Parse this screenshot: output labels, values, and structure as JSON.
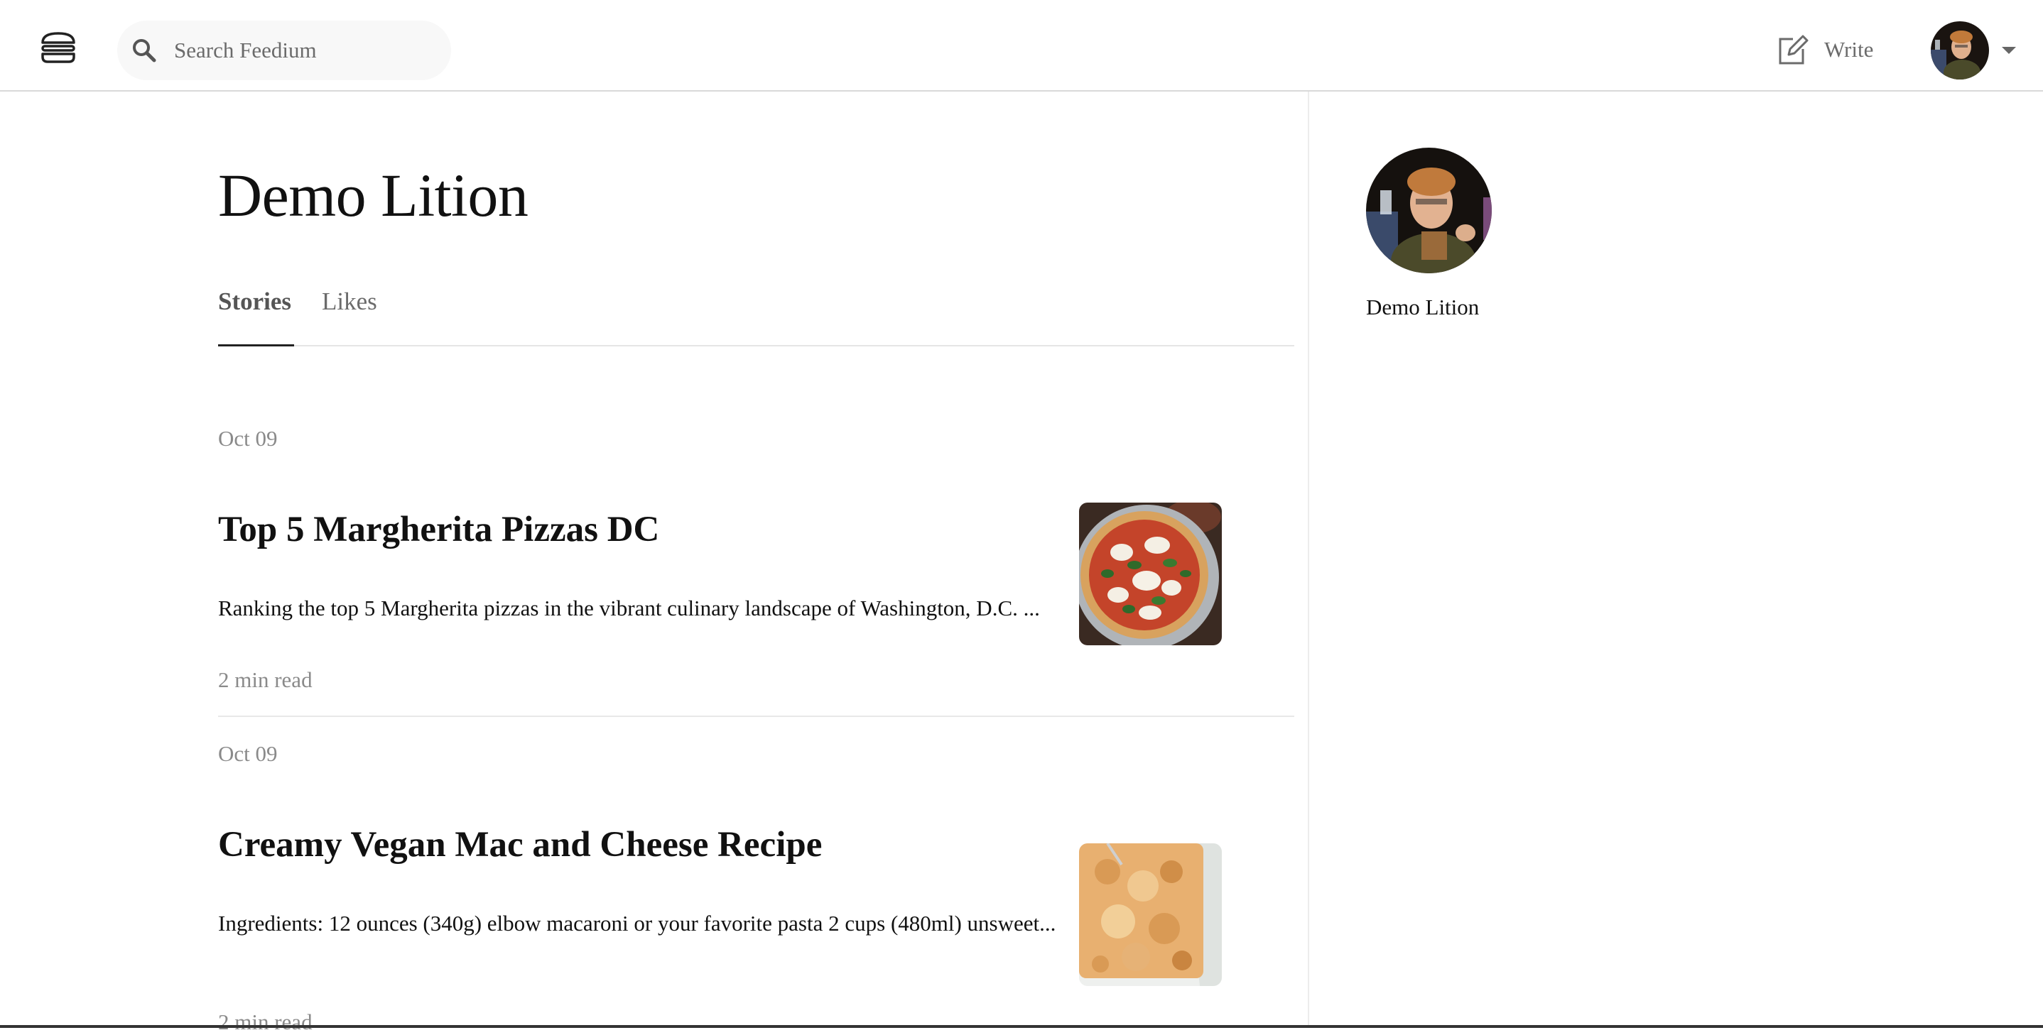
{
  "header": {
    "search_placeholder": "Search Feedium",
    "write_label": "Write"
  },
  "profile": {
    "name": "Demo Lition",
    "sidebar_name": "Demo Lition"
  },
  "tabs": [
    {
      "label": "Stories",
      "active": true
    },
    {
      "label": "Likes",
      "active": false
    }
  ],
  "stories": [
    {
      "date": "Oct 09",
      "title": "Top 5 Margherita Pizzas DC",
      "excerpt": "Ranking the top 5 Margherita pizzas in the vibrant culinary landscape of Washington, D.C. ...",
      "read_time": "2 min read",
      "thumbnail_icon": "pizza-image"
    },
    {
      "date": "Oct 09",
      "title": "Creamy Vegan Mac and Cheese Recipe",
      "excerpt": "Ingredients: 12 ounces (340g) elbow macaroni or your favorite pasta 2 cups (480ml) unsweet...",
      "read_time": "2 min read",
      "thumbnail_icon": "mac-and-cheese-image"
    }
  ],
  "colors": {
    "muted_text": "#8a8a8a",
    "tab_inactive": "#6b6b6b",
    "search_bg": "#f8f8f8"
  }
}
